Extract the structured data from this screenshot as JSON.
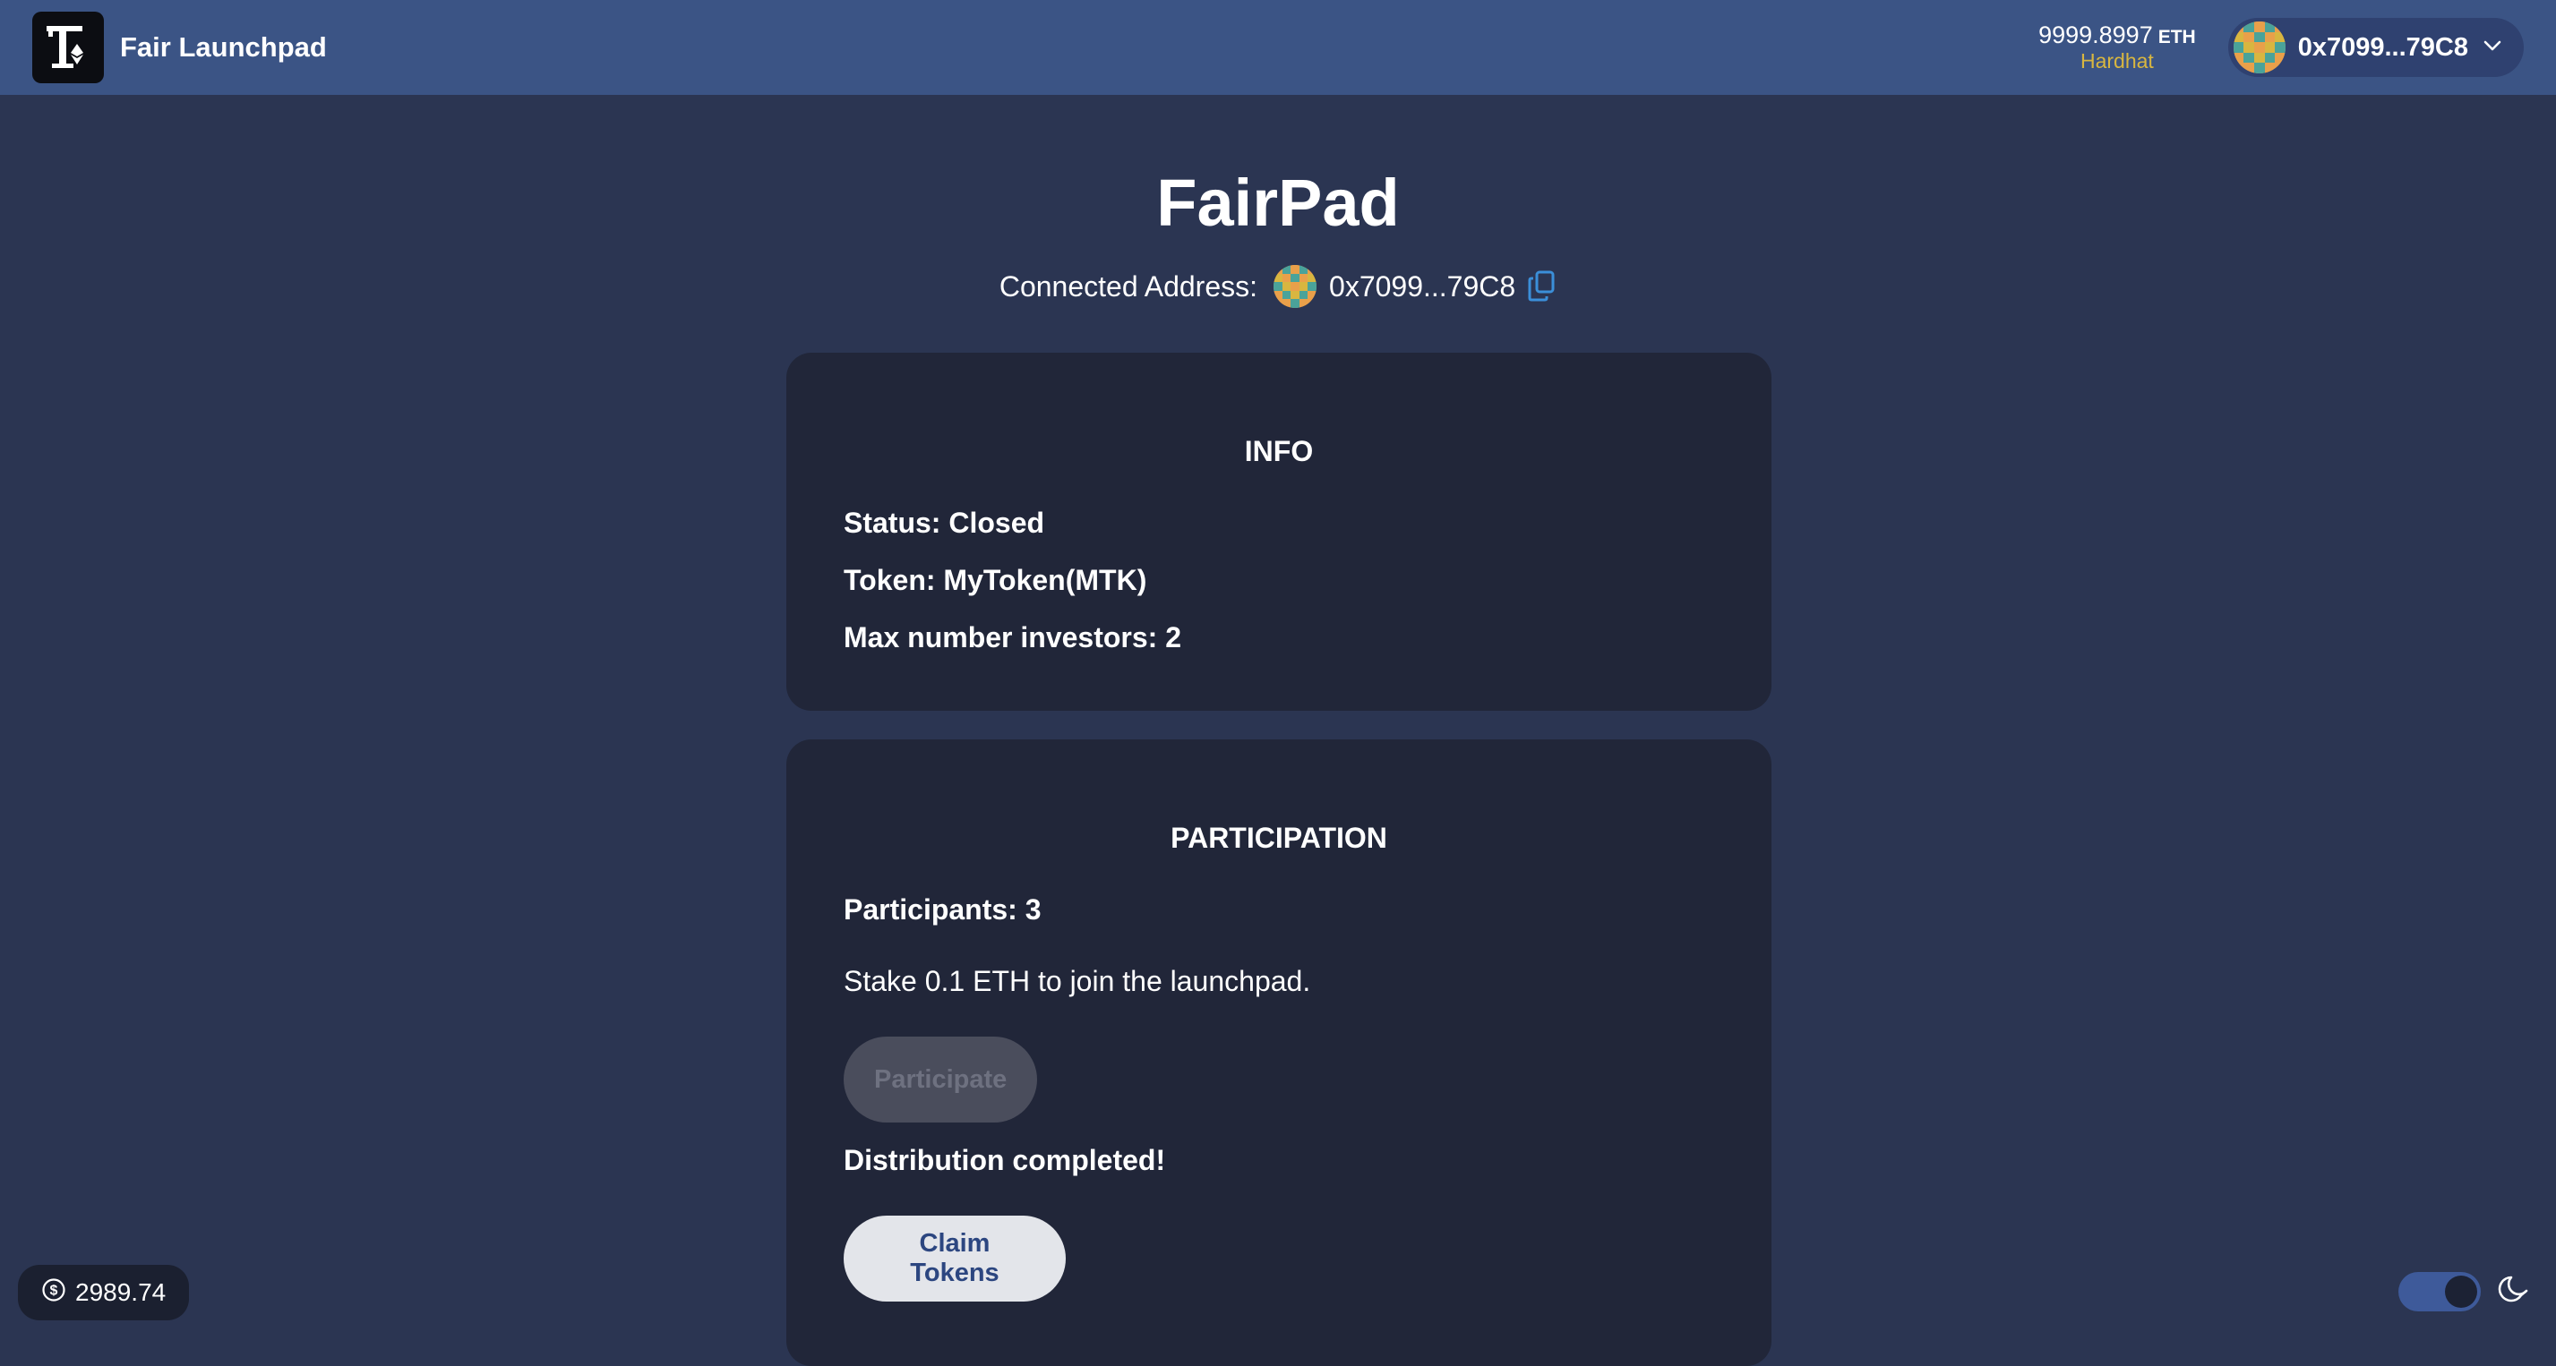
{
  "navbar": {
    "brand_name": "Fair Launchpad",
    "balance_value": "9999.8997",
    "balance_unit": "ETH",
    "network": "Hardhat",
    "account_address": "0x7099...79C8"
  },
  "header": {
    "title": "FairPad",
    "connected_label": "Connected Address:",
    "connected_address": "0x7099...79C8"
  },
  "info_card": {
    "heading": "INFO",
    "status": "Status: Closed",
    "token": "Token: MyToken(MTK)",
    "max_investors": "Max number investors: 2"
  },
  "participation_card": {
    "heading": "PARTICIPATION",
    "participants": "Participants: 3",
    "stake_text": "Stake 0.1 ETH to join the launchpad.",
    "participate_label": "Participate",
    "distribution_text": "Distribution completed!",
    "claim_label": "Claim Tokens"
  },
  "footer": {
    "eth_price": "2989.74",
    "theme": "dark"
  },
  "icons": {
    "logo": "launchpad-logo-icon",
    "chevron": "chevron-down-icon",
    "copy": "copy-icon",
    "dollar": "dollar-circle-icon",
    "moon": "moon-icon"
  },
  "colors": {
    "navbar": "#3b5485",
    "background": "#2b3552",
    "card": "#212639",
    "network": "#d8b640",
    "copy_icon": "#3b8fd9",
    "claim_text": "#2c4680"
  }
}
